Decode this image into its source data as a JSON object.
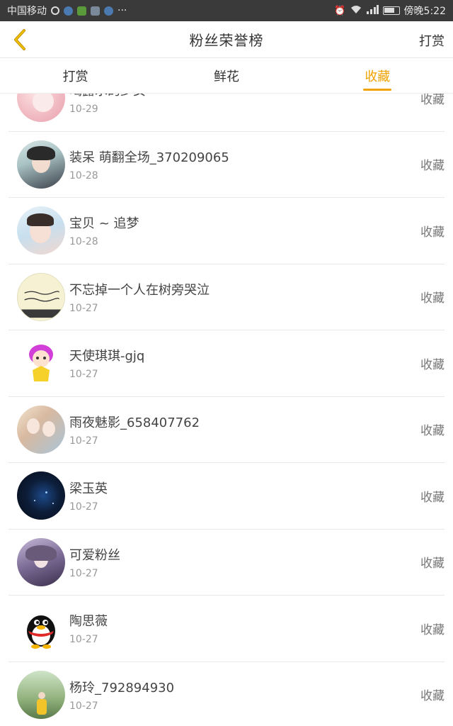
{
  "status_bar": {
    "carrier": "中国移动",
    "more": "···",
    "time": "傍晚5:22"
  },
  "nav": {
    "title": "粉丝荣誉榜",
    "action_label": "打赏"
  },
  "tabs": [
    {
      "label": "打赏",
      "active": false
    },
    {
      "label": "鲜花",
      "active": false
    },
    {
      "label": "收藏",
      "active": true
    }
  ],
  "colors": {
    "accent": "#f0a200",
    "back_arrow": "#b58a00"
  },
  "list": [
    {
      "name": "喝露水的少女",
      "date": "10-29",
      "type": "收藏",
      "avatar": "anime-girl-pink"
    },
    {
      "name": "装呆 萌翻全场_370209065",
      "date": "10-28",
      "type": "收藏",
      "avatar": "girl-photo"
    },
    {
      "name": "宝贝 ~ 追梦",
      "date": "10-28",
      "type": "收藏",
      "avatar": "girl-selfie"
    },
    {
      "name": "不忘掉一个人在树旁哭泣",
      "date": "10-27",
      "type": "收藏",
      "avatar": "handwriting-note"
    },
    {
      "name": "天使琪琪-gjq",
      "date": "10-27",
      "type": "收藏",
      "avatar": "cartoon-girl"
    },
    {
      "name": "雨夜魅影_658407762",
      "date": "10-27",
      "type": "收藏",
      "avatar": "anime-couple"
    },
    {
      "name": "梁玉英",
      "date": "10-27",
      "type": "收藏",
      "avatar": "galaxy"
    },
    {
      "name": "可爱粉丝",
      "date": "10-27",
      "type": "收藏",
      "avatar": "anime-girl-dark"
    },
    {
      "name": "陶思薇",
      "date": "10-27",
      "type": "收藏",
      "avatar": "qq-penguin"
    },
    {
      "name": "杨玲_792894930",
      "date": "10-27",
      "type": "收藏",
      "avatar": "person-outdoor"
    }
  ]
}
